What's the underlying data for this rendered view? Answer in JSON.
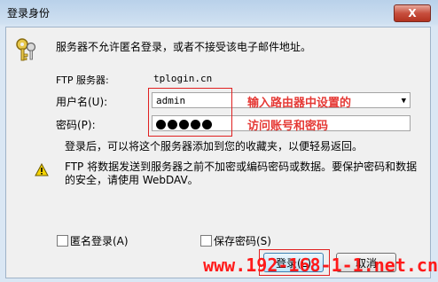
{
  "window": {
    "title": "登录身份",
    "close_glyph": "X"
  },
  "message": "服务器不允许匿名登录，或者不接受该电子邮件地址。",
  "ftp_server": {
    "label": "FTP 服务器:",
    "value": "tplogin.cn"
  },
  "username": {
    "label": "用户名(U):",
    "value": "admin"
  },
  "password": {
    "label": "密码(P):",
    "dots": 5
  },
  "annotation": {
    "line1": "输入路由器中设置的",
    "line2": "访问账号和密码"
  },
  "info_text": "登录后，可以将这个服务器添加到您的收藏夹，以便轻易返回。",
  "warning_text": "FTP 将数据发送到服务器之前不加密或编码密码或数据。要保护密码和数据的安全，请使用 WebDAV。",
  "anonymous_login": {
    "label": "匿名登录(A)",
    "checked": false
  },
  "save_password": {
    "label": "保存密码(S)",
    "checked": false
  },
  "buttons": {
    "login": "登录(L)",
    "cancel": "取消"
  },
  "watermark": "www.192-168-1-1.net.cn",
  "icons": {
    "keys": "keys-icon",
    "warning": "warning-icon",
    "dropdown": "dropdown-arrow-icon"
  },
  "colors": {
    "annotation_red": "#e53935",
    "watermark_red": "#ff1a1a"
  }
}
